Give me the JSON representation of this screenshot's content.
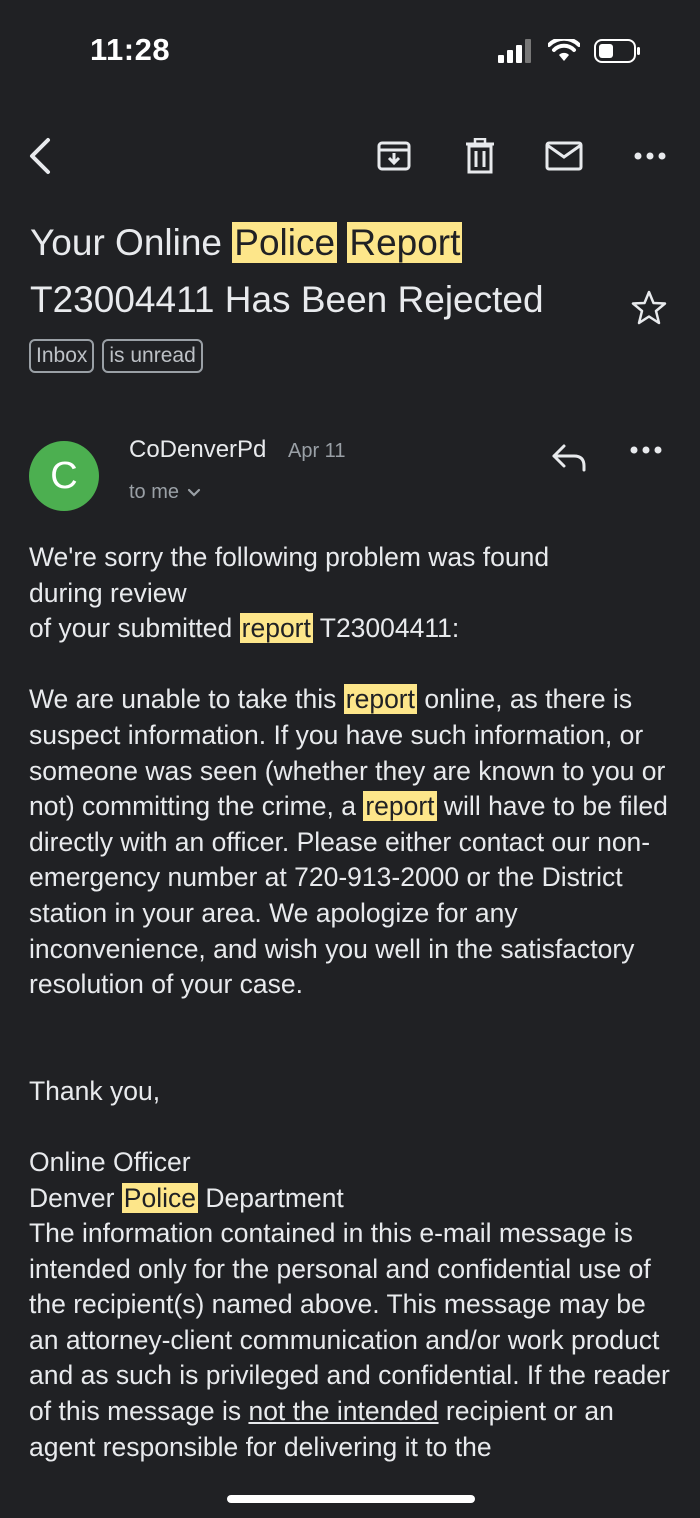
{
  "status_bar": {
    "time": "11:28"
  },
  "toolbar": {
    "back": "back-arrow-icon",
    "archive": "archive-icon",
    "delete": "trash-icon",
    "mark_unread": "mail-icon",
    "more": "more-dots-icon"
  },
  "email": {
    "subject_part1": "Your Online ",
    "subject_hl1": "Police",
    "subject_hl2": "Report",
    "subject_part2": "T23004411 Has Been Rejected",
    "labels": [
      "Inbox",
      "is unread"
    ],
    "sender_initial": "C",
    "sender": "CoDenverPd",
    "date": "Apr 11",
    "recipient": "to me",
    "body": {
      "line1": "We're sorry the following problem was found",
      "line2": "during review",
      "line3_pre": "of your submitted ",
      "hl_report": "report",
      "line3_post": " T23004411:",
      "p2_pre": "We are unable to take this ",
      "p2_mid1": " online, as there is suspect information. If you have such information, or someone was seen (whether they are known to you or not) committing the crime, a ",
      "p2_mid2": " will have to be filed directly with an officer. Please either contact our non-emergency number at 720-913-2000 or the District station in your area. We apologize for any inconvenience, and wish you well in the satisfactory resolution of your case.",
      "thanks": "Thank you,",
      "sig1": "Online Officer",
      "sig2_pre": "Denver ",
      "sig2_hl": "Police",
      "sig2_post": " Department",
      "disclaimer_a": "The information contained in this e-mail message is intended only for the personal and confidential use of the recipient(s) named above. This message may be an attorney-client communication and/or work product and as such is privileged and confidential. If the reader of this message is ",
      "disclaimer_u": "not the intended",
      "disclaimer_b": " recipient or an agent responsible for delivering it to the"
    }
  },
  "colors": {
    "background": "#202124",
    "highlight": "#fde68a",
    "avatar": "#4caf50"
  }
}
